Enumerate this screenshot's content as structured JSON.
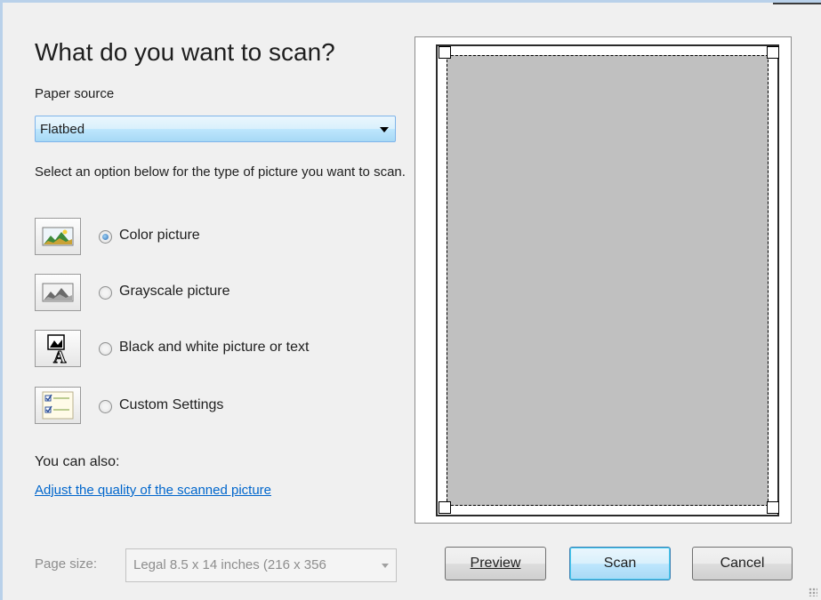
{
  "heading": "What do you want to scan?",
  "paper_source": {
    "label": "Paper source",
    "value": "Flatbed"
  },
  "instructions": "Select an option below for the type of picture you want to scan.",
  "options": [
    {
      "label": "Color picture",
      "checked": true,
      "icon": "color-picture-icon"
    },
    {
      "label": "Grayscale picture",
      "checked": false,
      "icon": "grayscale-picture-icon"
    },
    {
      "label": "Black and white picture or text",
      "checked": false,
      "icon": "black-white-text-icon"
    },
    {
      "label": "Custom Settings",
      "checked": false,
      "icon": "custom-settings-icon"
    }
  ],
  "also": {
    "label": "You can also:",
    "link": "Adjust the quality of the scanned picture"
  },
  "page_size": {
    "label": "Page size:",
    "value": "Legal 8.5 x 14 inches (216 x 356"
  },
  "buttons": {
    "preview": "Preview",
    "scan": "Scan",
    "cancel": "Cancel"
  },
  "colors": {
    "accent": "#7eb4ea",
    "link": "#0066cc",
    "scan_area": "#c0c0c0"
  }
}
